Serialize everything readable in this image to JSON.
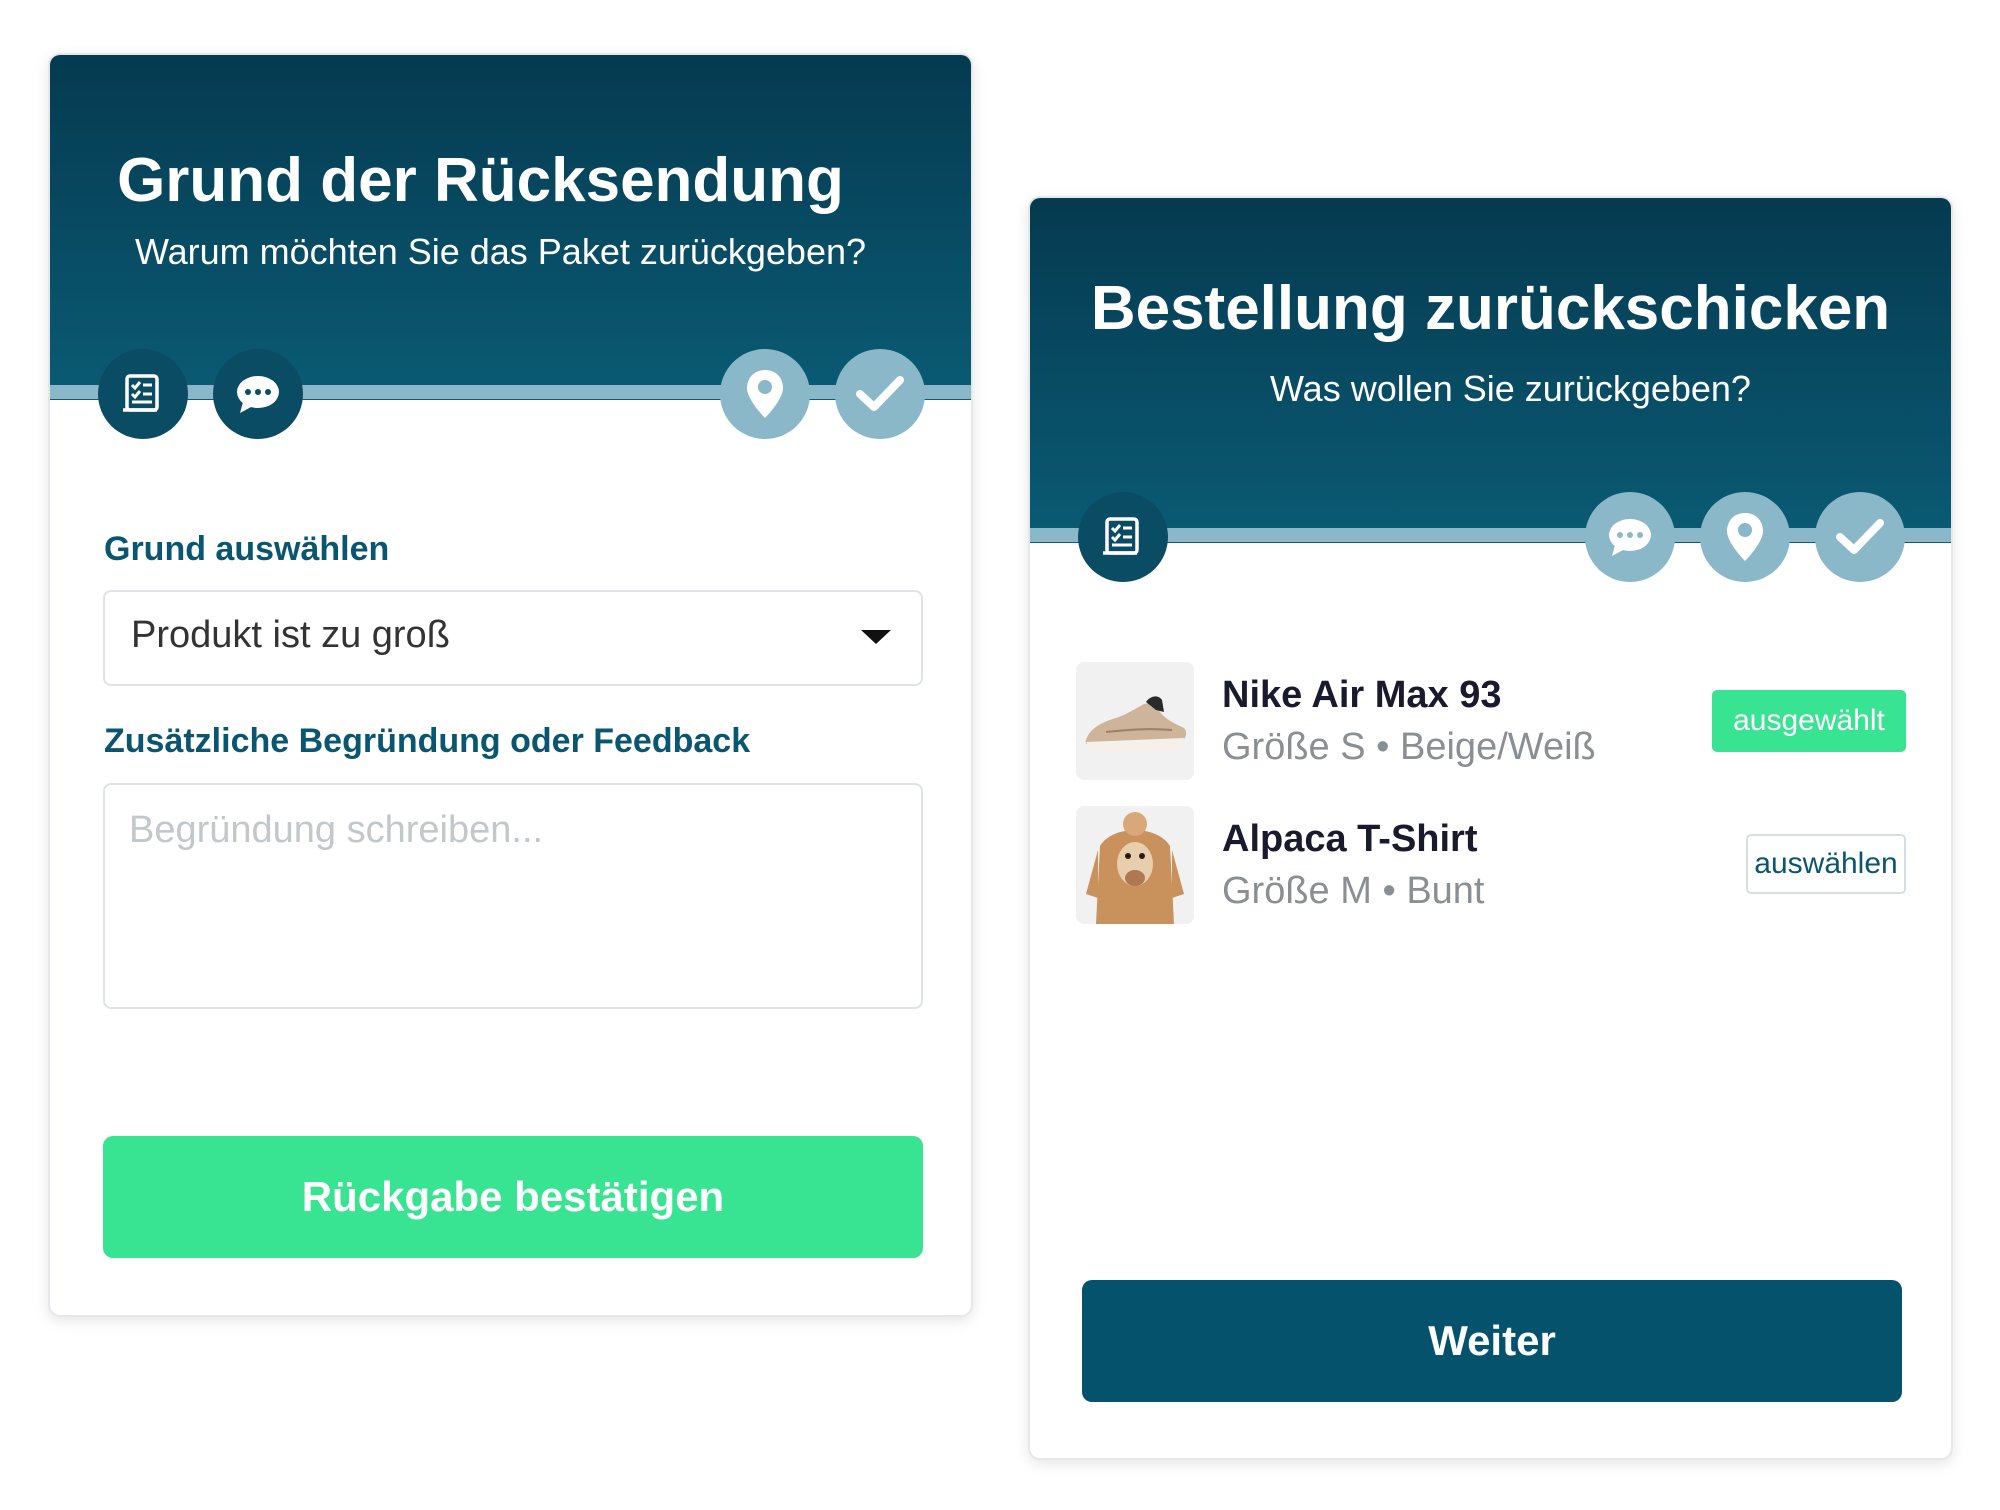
{
  "left_card": {
    "title": "Grund der Rücksendung",
    "subtitle": "Warum möchten Sie das Paket zurückgeben?",
    "steps": [
      {
        "icon": "checklist-icon",
        "state": "active"
      },
      {
        "icon": "chat-icon",
        "state": "active"
      },
      {
        "icon": "location-pin-icon",
        "state": "inactive"
      },
      {
        "icon": "checkmark-icon",
        "state": "inactive"
      }
    ],
    "reason_label": "Grund auswählen",
    "reason_value": "Produkt ist zu groß",
    "feedback_label": "Zusätzliche Begründung oder Feedback",
    "feedback_placeholder": "Begründung schreiben...",
    "confirm_button": "Rückgabe bestätigen"
  },
  "right_card": {
    "title": "Bestellung zurückschicken",
    "subtitle": "Was wollen Sie zurückgeben?",
    "steps": [
      {
        "icon": "checklist-icon",
        "state": "active"
      },
      {
        "icon": "chat-icon",
        "state": "inactive"
      },
      {
        "icon": "location-pin-icon",
        "state": "inactive"
      },
      {
        "icon": "checkmark-icon",
        "state": "inactive"
      }
    ],
    "products": [
      {
        "name": "Nike Air Max 93",
        "meta": "Größe S • Beige/Weiß",
        "status": "ausgewählt",
        "selected": true,
        "image": "sneaker-image"
      },
      {
        "name": "Alpaca T-Shirt",
        "meta": "Größe M • Bunt",
        "status": "auswählen",
        "selected": false,
        "image": "alpaca-shirt-image"
      }
    ],
    "next_button": "Weiter"
  },
  "colors": {
    "header_dark": "#053a50",
    "header_light": "#0a5b74",
    "accent_green": "#38e391",
    "primary_dark": "#05526c",
    "step_inactive": "#8ab8c9",
    "label_teal": "#0a5670"
  }
}
